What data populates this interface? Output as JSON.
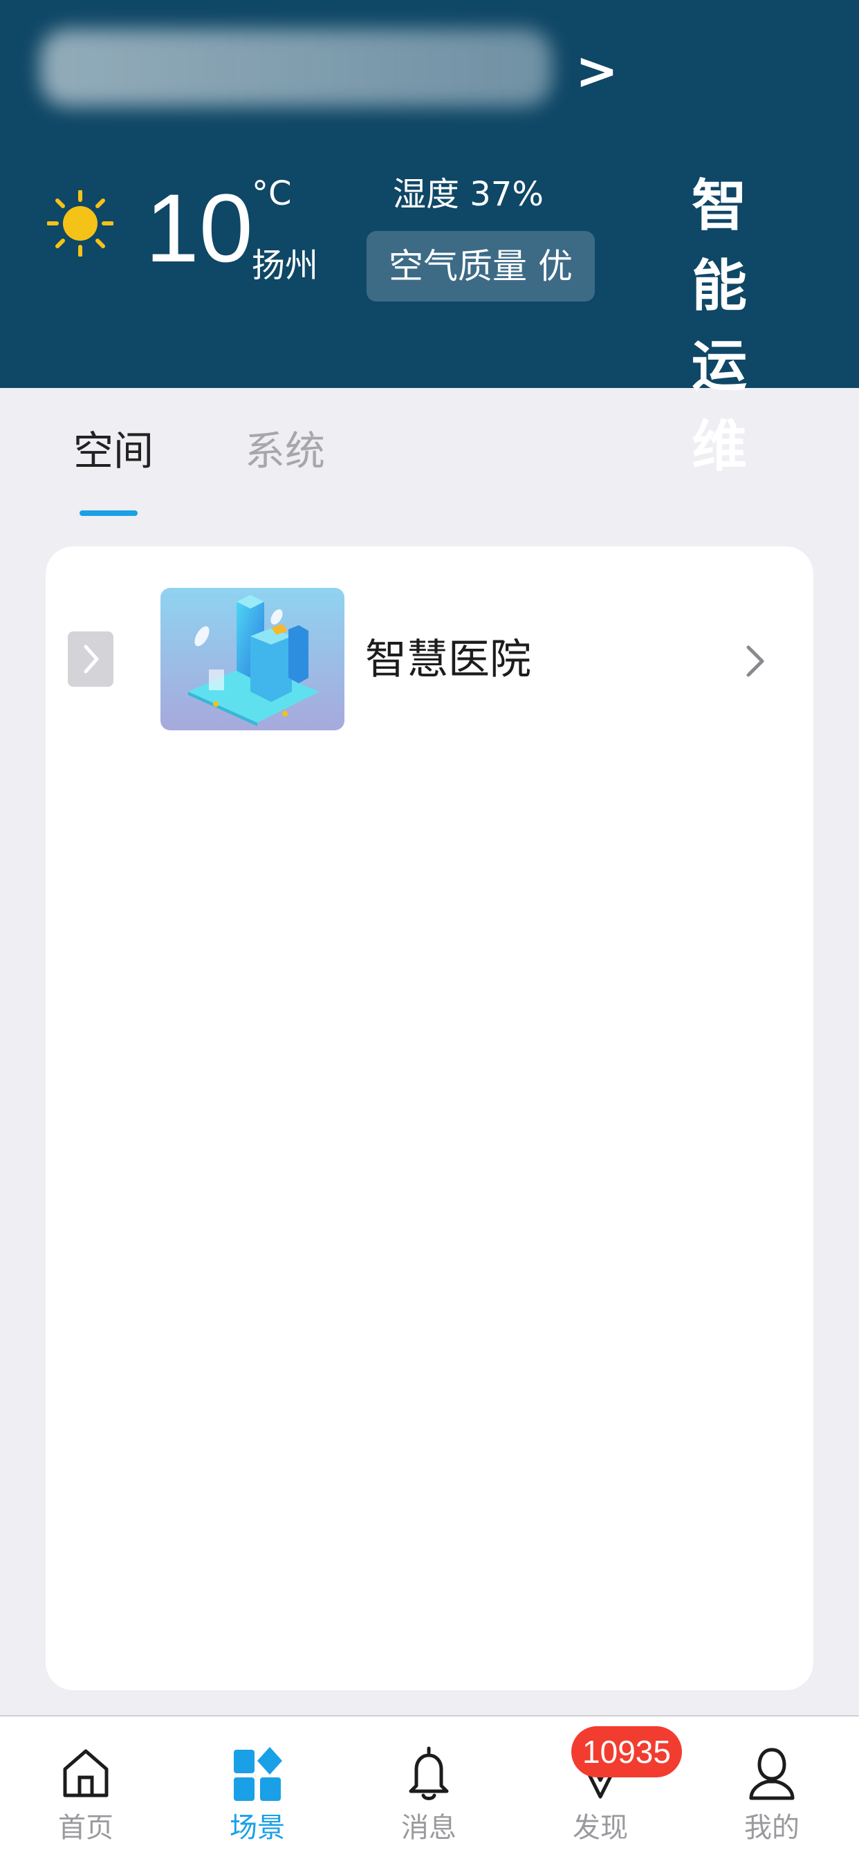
{
  "header": {
    "project_arrow": ">",
    "weather": {
      "icon": "sun-icon",
      "temperature": "10",
      "unit": "°C",
      "city": "扬州",
      "humidity": "湿度 37%",
      "air_quality": "空气质量 优"
    },
    "smart_ops_label": "智能运维"
  },
  "tabs": [
    {
      "label": "空间",
      "active": true
    },
    {
      "label": "系统",
      "active": false
    }
  ],
  "spaces": [
    {
      "name": "智慧医院",
      "thumbnail": "city-illustration"
    }
  ],
  "tabbar": {
    "items": [
      {
        "label": "首页",
        "icon": "home-icon",
        "active": false
      },
      {
        "label": "场景",
        "icon": "scene-grid-icon",
        "active": true
      },
      {
        "label": "消息",
        "icon": "bell-icon",
        "active": false
      },
      {
        "label": "发现",
        "icon": "discover-icon",
        "active": false
      },
      {
        "label": "我的",
        "icon": "profile-icon",
        "active": false
      }
    ],
    "discover_badge": "10935"
  },
  "colors": {
    "header_bg": "#0f4766",
    "accent": "#1aa0e6",
    "badge": "#f23c30",
    "sun": "#f5c218"
  }
}
